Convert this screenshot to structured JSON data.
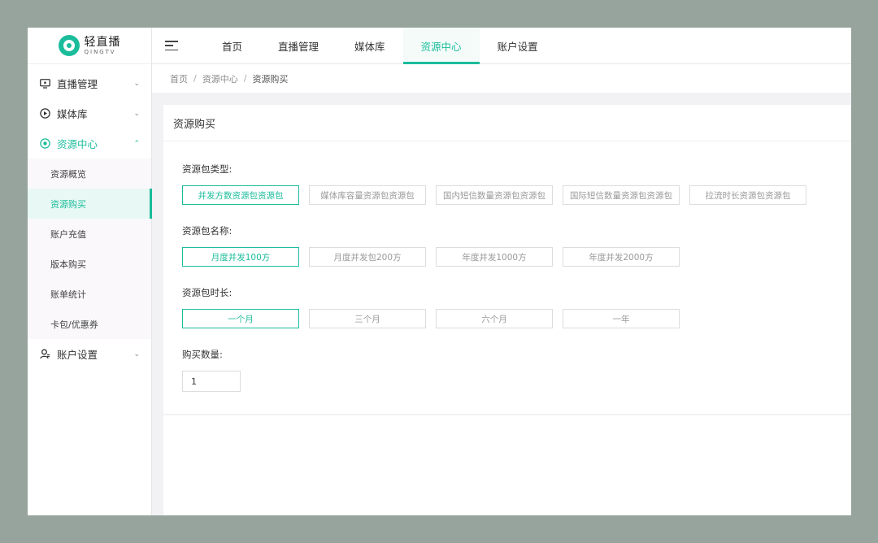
{
  "logo": {
    "cn": "轻直播",
    "en": "QINGTV"
  },
  "sidebar": {
    "groups": [
      {
        "label": "直播管理",
        "icon": "monitor-icon"
      },
      {
        "label": "媒体库",
        "icon": "play-circle-icon"
      },
      {
        "label": "资源中心",
        "icon": "target-icon"
      },
      {
        "label": "账户设置",
        "icon": "user-icon"
      }
    ],
    "resource_sub": [
      {
        "label": "资源概览"
      },
      {
        "label": "资源购买"
      },
      {
        "label": "账户充值"
      },
      {
        "label": "版本购买"
      },
      {
        "label": "账单统计"
      },
      {
        "label": "卡包/优惠券"
      }
    ]
  },
  "topnav": {
    "tabs": [
      {
        "label": "首页"
      },
      {
        "label": "直播管理"
      },
      {
        "label": "媒体库"
      },
      {
        "label": "资源中心"
      },
      {
        "label": "账户设置"
      }
    ],
    "active_index": 3
  },
  "breadcrumb": {
    "items": [
      "首页",
      "资源中心",
      "资源购买"
    ],
    "separator": "/"
  },
  "panel": {
    "title": "资源购买",
    "type": {
      "label": "资源包类型:",
      "options": [
        "并发方数资源包资源包",
        "媒体库容量资源包资源包",
        "国内短信数量资源包资源包",
        "国际短信数量资源包资源包",
        "拉流时长资源包资源包"
      ],
      "selected": 0
    },
    "name": {
      "label": "资源包名称:",
      "options": [
        "月度并发100方",
        "月度并发包200方",
        "年度并发1000方",
        "年度并发2000方"
      ],
      "selected": 0
    },
    "duration": {
      "label": "资源包时长:",
      "options": [
        "一个月",
        "三个月",
        "六个月",
        "一年"
      ],
      "selected": 0
    },
    "quantity": {
      "label": "购买数量:",
      "value": "1"
    }
  },
  "colors": {
    "accent": "#1bbc9b",
    "backdrop": "#97a49d"
  }
}
